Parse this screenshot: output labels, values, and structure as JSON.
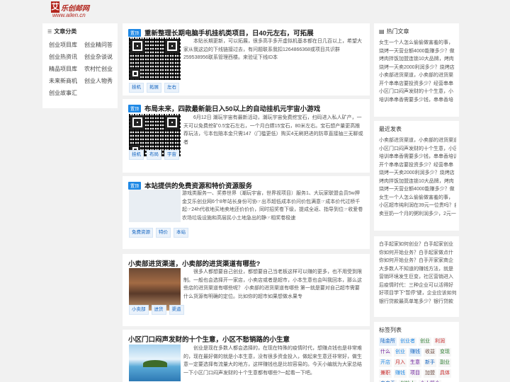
{
  "header": {
    "logo_mark": "艾",
    "logo_name": "乐创邮网",
    "logo_url": "www.ailen.cn"
  },
  "left": {
    "title": "文章分类",
    "items": [
      "创业项目库",
      "创业精问答",
      "创业热资讯",
      "创业杂谈说",
      "精品项目库",
      "农村忙创业",
      "未来新商机",
      "创业人物秀",
      "创业故事汇"
    ]
  },
  "articles": [
    {
      "badge": "置顶",
      "title": "重新整理长期电脑手机挂机类项目，日40元左右，可拓展",
      "excerpt": "本贴长期更新，可以拓展，很多高手多开虚拟机基本都在日几百以上，希望大家从我这边的下线链接过去，有问题联系我扣1264866368或项目共识群259538956联系管理西楼。来验证下线ID本",
      "tags": [
        "挂机",
        "拓展",
        "左右"
      ]
    },
    {
      "badge": "置顶",
      "title": "布局未来，四款最新能日入50以上的自动挂机元宇宙小游戏",
      "excerpt": "6月12日 潮玩宇宙有最新活动，潮玩宇宙免费挖宝石，扫码进入私人矿产，一天可以免费挖矿0.5宝石左右，一个月白嫖15宝石，80米左右。宝石想产量更高推荐玩法，亏本包赔本金只需147（门槛更低）购买4无刷把进的防章直接抽三无聊或者",
      "tags": [
        "挂机",
        "布局",
        "宇宙"
      ]
    },
    {
      "badge": "置顶",
      "title": "本站提供的免费资源和特价资源服务",
      "excerpt": "游戏类服务一、奖券世界（潮玩宇宙，世界视项目）服务1、大玩家联盟会员5w押金艾乐创业网6个8年站长身份可协☞出币超低成本价问价包满意☞成本价代过桥千起☞24h代收地买地卖地还价价价，同时招奖卷下级，提成全返、指导到位☞收爱卷农场垃圾设施和高层民小土地急出的静☞相奖卷极速",
      "tags": [
        "免费资源",
        "特价",
        "本站"
      ]
    },
    {
      "title": "小卖部进货渠道，小卖部的进货渠道有哪些?",
      "excerpt": "很多人都想要自己创业，都想要自己当老板这样可以赚的更多，也不用受到限制。一般也会选择开一家店，小卖店或者是超市，小本生意也会叫我回本，那么这些店的进货渠道有哪些呢？ 小卖部的进货渠道有哪些 第一就是要对自己超市需要什么货源有明确的定位。比如你的超市如果想做水果专",
      "tags": [
        "小卖部",
        "进货",
        "渠道"
      ]
    },
    {
      "title": "小区门口闷声发财的十个生意，小区不愁销路的小生意",
      "excerpt": "创业是现在多数人都会选择的，在现在特殊的疫情时代，想赚点钱也是非常难的，现在最好做的就是小本生意，没有很多资金投入，做起来生意还非常好，做生意一定要选择有流量大的地方，这样赚钱也是比较容易的。今天小编就为大家总结一下小区门口闷声发财的十个生意都有哪些?一起看一下吧。",
      "tags": []
    }
  ],
  "right": {
    "hot_title": "热门文章",
    "hot_items": [
      "女生一个人怎么偷偷做害羞的事，",
      "烧烤一天营业额4000能赚多少？做",
      "烤肉拌饭加盟连锁10大品牌，烤肉",
      "烧烤一天卖2000利润多少？烧烤店",
      "小卖部进货渠道，小卖部的进货渠",
      "开个串串店要投资多少？经营串串",
      "小区门口闷声发财的十个生意，小",
      "培训串串香需要多少钱，串串香培"
    ],
    "recent_title": "最近发表",
    "recent_items": [
      "小卖部进货渠道，小卖部的进货渠道",
      "小区门口闷声发财的十个生意，小区",
      "培训串串香需要多少钱，串串香培训",
      "开个串串店要投资多少？经营串串",
      "烧烤一天卖2000利润多少？烧烤店",
      "烤肉拌饭加盟连锁10大品牌，烤肉",
      "烧烤一天营业额4000能赚多少？做",
      "女生一个人怎么偷偷做害羞的事，",
      "小区超市纯利润在39元一位贵吗？自助烧烤",
      "卖豆奶一个月的粥利润多少，2元一杯"
    ],
    "misc_items": [
      "白手起家如何创业？白手起家创业",
      "你如何开始业务？白手起家做点什",
      "你如何开始业务？白手开家家商企",
      "大多数人不知道的赚钱方法，就是",
      "营销环境发生巨变，社区营销进入",
      "后疫情时代：三种企业可以活得好",
      "好项目学下“暂停”键，企业应该如何",
      "银行贷款最高单笔多少？银行贷款"
    ],
    "tag_title": "标签列表",
    "tags": [
      {
        "t": "陆金所",
        "c": "#e6f0fa",
        "f": "#1565c0"
      },
      {
        "t": "创业者",
        "c": "#f6f6f6",
        "f": "#1e88e5"
      },
      {
        "t": "创业",
        "c": "#f6f6f6",
        "f": "#2e7d32"
      },
      {
        "t": "利润",
        "c": "#f6f6f6",
        "f": "#c62828"
      },
      {
        "t": "什么",
        "c": "#f6f6f6",
        "f": "#6a1b9a"
      },
      {
        "t": "创业",
        "c": "#f6f6f6",
        "f": "#1e88e5"
      },
      {
        "t": "赚钱",
        "c": "#e6f0fa",
        "f": "#1565c0"
      },
      {
        "t": "收益",
        "c": "#f6f6f6",
        "f": "#6d4c41"
      },
      {
        "t": "变现",
        "c": "#f6f6f6",
        "f": "#2e7d32"
      },
      {
        "t": "开店",
        "c": "#f6f6f6",
        "f": "#1e88e5"
      },
      {
        "t": "月入",
        "c": "#f6f6f6",
        "f": "#c62828"
      },
      {
        "t": "生意",
        "c": "#f6f6f6",
        "f": "#6a1b9a"
      },
      {
        "t": "新手",
        "c": "#f6f6f6",
        "f": "#1565c0"
      },
      {
        "t": "副业",
        "c": "#f6f6f6",
        "f": "#2e7d32"
      },
      {
        "t": "兼职",
        "c": "#f6f6f6",
        "f": "#c62828"
      },
      {
        "t": "赚钱",
        "c": "#f6f6f6",
        "f": "#1e88e5"
      },
      {
        "t": "项目",
        "c": "#f6f6f6",
        "f": "#6a1b9a"
      },
      {
        "t": "加盟",
        "c": "#f6f6f6",
        "f": "#6d4c41"
      },
      {
        "t": "具体",
        "c": "#f6f6f6",
        "f": "#c62828"
      },
      {
        "t": "串串香",
        "c": "#f6f6f6",
        "f": "#1565c0"
      },
      {
        "t": "创始人",
        "c": "#f6f6f6",
        "f": "#2e7d32"
      },
      {
        "t": "个人简介",
        "c": "#f6f6f6",
        "f": "#6a1b9a"
      }
    ]
  }
}
